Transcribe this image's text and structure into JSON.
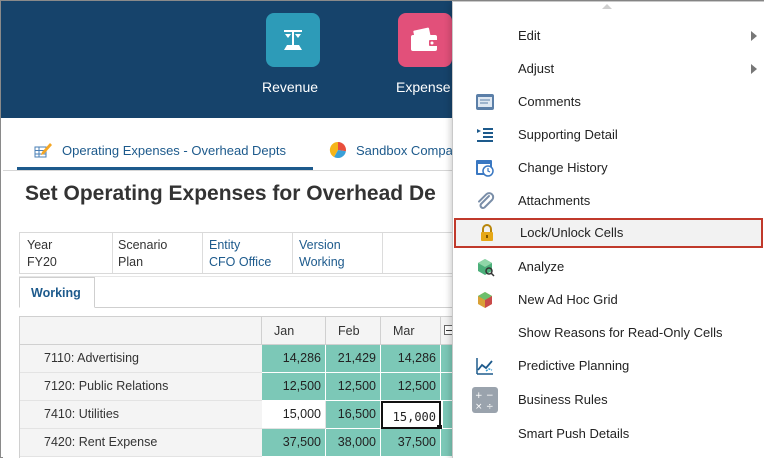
{
  "header": {
    "tiles": [
      {
        "label": "Revenue",
        "icon": "scale-icon",
        "color": "#2d9bb8"
      },
      {
        "label": "Expense",
        "icon": "wallet-icon",
        "color": "#e2507a"
      }
    ],
    "background": "#16436b"
  },
  "tabs": [
    {
      "label": "Operating Expenses - Overhead Depts",
      "icon": "pencil-grid-icon",
      "active": true
    },
    {
      "label": "Sandbox Compa",
      "icon": "pie-chart-icon",
      "active": false
    }
  ],
  "page_title": "Set Operating Expenses for Overhead De",
  "pov": [
    {
      "label": "Year",
      "value": "FY20",
      "link": false
    },
    {
      "label": "Scenario",
      "value": "Plan",
      "link": false
    },
    {
      "label": "Entity",
      "value": "CFO Office",
      "link": true
    },
    {
      "label": "Version",
      "value": "Working",
      "link": true
    }
  ],
  "working_tab": "Working",
  "grid": {
    "columns": [
      "Jan",
      "Feb",
      "Mar"
    ],
    "rows": [
      {
        "label": "7110: Advertising",
        "values": [
          "14,286",
          "21,429",
          "14,286"
        ],
        "cell_style": [
          "teal",
          "teal",
          "teal"
        ]
      },
      {
        "label": "7120: Public Relations",
        "values": [
          "12,500",
          "12,500",
          "12,500"
        ],
        "cell_style": [
          "teal",
          "teal",
          "teal"
        ]
      },
      {
        "label": "7410: Utilities",
        "values": [
          "15,000",
          "16,500",
          "15,000"
        ],
        "cell_style": [
          "white",
          "teal",
          "selected"
        ]
      },
      {
        "label": "7420: Rent Expense",
        "values": [
          "37,500",
          "38,000",
          "37,500"
        ],
        "cell_style": [
          "teal",
          "teal",
          "teal"
        ]
      }
    ],
    "teal_color": "#7cc8b7"
  },
  "context_menu": {
    "items": [
      {
        "label": "Edit",
        "icon": "",
        "submenu": true
      },
      {
        "label": "Adjust",
        "icon": "",
        "submenu": true
      },
      {
        "label": "Comments",
        "icon": "comment-icon"
      },
      {
        "label": "Supporting Detail",
        "icon": "supporting-detail-icon"
      },
      {
        "label": "Change History",
        "icon": "history-icon"
      },
      {
        "label": "Attachments",
        "icon": "paperclip-icon"
      },
      {
        "label": "Lock/Unlock Cells",
        "icon": "lock-icon",
        "highlighted": true
      },
      {
        "label": "Analyze",
        "icon": "analyze-icon"
      },
      {
        "label": "New Ad Hoc Grid",
        "icon": "ad-hoc-grid-icon"
      },
      {
        "label": "Show Reasons for Read-Only Cells",
        "icon": ""
      },
      {
        "label": "Predictive Planning",
        "icon": "trend-chart-icon"
      },
      {
        "label": "Business Rules",
        "icon": "calculator-icon"
      },
      {
        "label": "Smart Push Details",
        "icon": ""
      }
    ],
    "highlight_border_color": "#c0392b"
  }
}
